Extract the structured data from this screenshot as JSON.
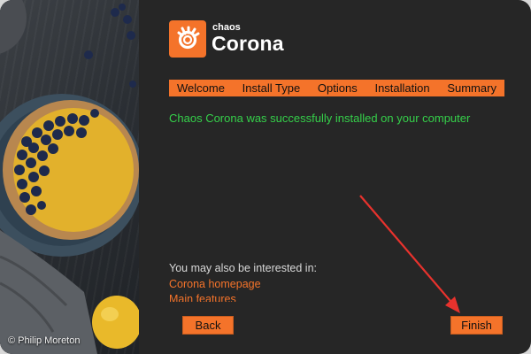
{
  "photo": {
    "credit": "© Philip Moreton"
  },
  "logo": {
    "brand": "chaos",
    "product": "Corona"
  },
  "steps": [
    {
      "label": "Welcome"
    },
    {
      "label": "Install Type"
    },
    {
      "label": "Options"
    },
    {
      "label": "Installation"
    },
    {
      "label": "Summary"
    }
  ],
  "message": {
    "success": "Chaos Corona was successfully installed on your computer"
  },
  "interest": {
    "heading": "You may also be interested in:",
    "links": [
      "Corona homepage",
      "Main features"
    ]
  },
  "buttons": {
    "back": "Back",
    "finish": "Finish"
  },
  "colors": {
    "accent": "#f4732a",
    "success": "#35d04a",
    "background": "#262626",
    "annotation": "#e8322d"
  }
}
